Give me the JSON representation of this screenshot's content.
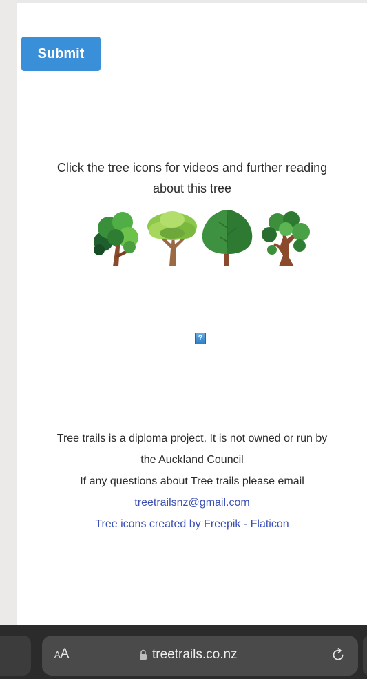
{
  "form": {
    "submit_label": "Submit"
  },
  "instructions": {
    "line1": "Click the tree icons for videos and further reading",
    "line2": "about this tree"
  },
  "trees": [
    "tree-icon-1",
    "tree-icon-2",
    "tree-icon-3",
    "tree-icon-4"
  ],
  "help": {
    "icon_label": "?"
  },
  "footer": {
    "line1": "Tree trails is a diploma project. It is not owned or run by",
    "line2": "the Auckland Council",
    "line3": "If any questions about Tree trails please email",
    "email": "treetrailsnz@gmail.com",
    "credit": "Tree icons created by Freepik - Flaticon"
  },
  "browser": {
    "aa_large": "A",
    "aa_small": "A",
    "url": "treetrails.co.nz"
  },
  "colors": {
    "accent": "#3a8fd9",
    "link": "#3a4fb5",
    "browser_bar": "#2b2b2b"
  }
}
